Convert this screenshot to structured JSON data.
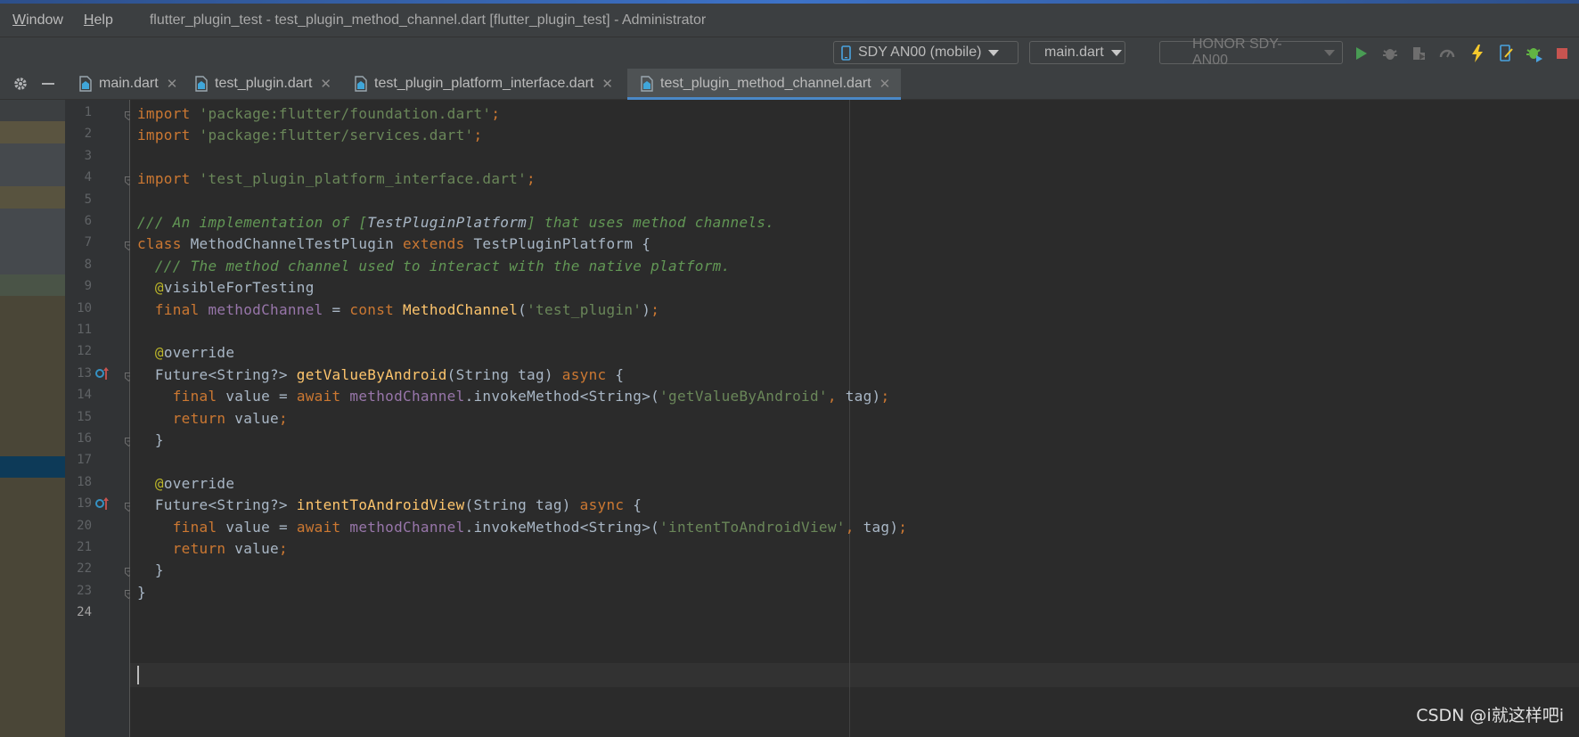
{
  "menubar": {
    "items": [
      {
        "label": "Window",
        "mnemonic": "W",
        "rest": "indow"
      },
      {
        "label": "Help",
        "mnemonic": "H",
        "rest": "elp"
      }
    ],
    "window_title": "flutter_plugin_test - test_plugin_method_channel.dart [flutter_plugin_test] - Administrator"
  },
  "toolbar": {
    "device_selector": "SDY AN00 (mobile)",
    "run_config": "main.dart",
    "device_list": "HONOR SDY-AN00",
    "icons": [
      "run-icon",
      "debug-icon",
      "coverage-icon",
      "profile-icon",
      "hot-reload-icon",
      "device-manager-icon",
      "attach-debugger-icon",
      "stop-icon"
    ],
    "colors": {
      "run": "#499c54",
      "reload": "#f4c82d",
      "stop": "#c75450"
    }
  },
  "tabs": [
    {
      "label": "main.dart"
    },
    {
      "label": "test_plugin.dart"
    },
    {
      "label": "test_plugin_platform_interface.dart"
    },
    {
      "label": "test_plugin_method_channel.dart",
      "active": true
    }
  ],
  "editor": {
    "current_line": 24,
    "lines": [
      [
        [
          "kw",
          "import "
        ],
        [
          "str",
          "'package:flutter/foundation.dart'"
        ],
        [
          "kw",
          ";"
        ]
      ],
      [
        [
          "kw",
          "import "
        ],
        [
          "str",
          "'package:flutter/services.dart'"
        ],
        [
          "kw",
          ";"
        ]
      ],
      [],
      [
        [
          "kw",
          "import "
        ],
        [
          "str",
          "'test_plugin_platform_interface.dart'"
        ],
        [
          "kw",
          ";"
        ]
      ],
      [],
      [
        [
          "doc",
          "/// An implementation of ["
        ],
        [
          "plaindoc",
          "TestPluginPlatform"
        ],
        [
          "doc",
          "] that uses method channels."
        ]
      ],
      [
        [
          "kw",
          "class "
        ],
        [
          "pl",
          "MethodChannelTestPlugin "
        ],
        [
          "kw",
          "extends "
        ],
        [
          "pl",
          "TestPluginPlatform {"
        ]
      ],
      [
        [
          "pl",
          "  "
        ],
        [
          "doc",
          "/// The method channel used to interact with the native platform."
        ]
      ],
      [
        [
          "pl",
          "  "
        ],
        [
          "ann",
          "@"
        ],
        [
          "pl",
          "visibleForTesting"
        ]
      ],
      [
        [
          "pl",
          "  "
        ],
        [
          "kw",
          "final "
        ],
        [
          "fld",
          "methodChannel "
        ],
        [
          "pl",
          "= "
        ],
        [
          "kw",
          "const "
        ],
        [
          "fn",
          "MethodChannel"
        ],
        [
          "pl",
          "("
        ],
        [
          "str",
          "'test_plugin'"
        ],
        [
          "pl",
          ")"
        ],
        [
          "kw",
          ";"
        ]
      ],
      [],
      [
        [
          "pl",
          "  "
        ],
        [
          "ann",
          "@"
        ],
        [
          "pl",
          "override"
        ]
      ],
      [
        [
          "pl",
          "  Future<String?> "
        ],
        [
          "fn",
          "getValueByAndroid"
        ],
        [
          "pl",
          "(String tag) "
        ],
        [
          "kw",
          "async "
        ],
        [
          "pl",
          "{"
        ]
      ],
      [
        [
          "pl",
          "    "
        ],
        [
          "kw",
          "final "
        ],
        [
          "pl",
          "value = "
        ],
        [
          "kw",
          "await "
        ],
        [
          "fld",
          "methodChannel"
        ],
        [
          "pl",
          ".invokeMethod<String>("
        ],
        [
          "str",
          "'getValueByAndroid'"
        ],
        [
          "kw",
          ", "
        ],
        [
          "pl",
          "tag)"
        ],
        [
          "kw",
          ";"
        ]
      ],
      [
        [
          "pl",
          "    "
        ],
        [
          "kw",
          "return "
        ],
        [
          "pl",
          "value"
        ],
        [
          "kw",
          ";"
        ]
      ],
      [
        [
          "pl",
          "  }"
        ]
      ],
      [],
      [
        [
          "pl",
          "  "
        ],
        [
          "ann",
          "@"
        ],
        [
          "pl",
          "override"
        ]
      ],
      [
        [
          "pl",
          "  Future<String?> "
        ],
        [
          "fn",
          "intentToAndroidView"
        ],
        [
          "pl",
          "(String tag) "
        ],
        [
          "kw",
          "async "
        ],
        [
          "pl",
          "{"
        ]
      ],
      [
        [
          "pl",
          "    "
        ],
        [
          "kw",
          "final "
        ],
        [
          "pl",
          "value = "
        ],
        [
          "kw",
          "await "
        ],
        [
          "fld",
          "methodChannel"
        ],
        [
          "pl",
          ".invokeMethod<String>("
        ],
        [
          "str",
          "'intentToAndroidView'"
        ],
        [
          "kw",
          ", "
        ],
        [
          "pl",
          "tag)"
        ],
        [
          "kw",
          ";"
        ]
      ],
      [
        [
          "pl",
          "    "
        ],
        [
          "kw",
          "return "
        ],
        [
          "pl",
          "value"
        ],
        [
          "kw",
          ";"
        ]
      ],
      [
        [
          "pl",
          "  }"
        ]
      ],
      [
        [
          "pl",
          "}"
        ]
      ],
      []
    ],
    "override_marker_lines": [
      13,
      19
    ],
    "fold_marker_lines": [
      1,
      4,
      7,
      13,
      16,
      19,
      22,
      23
    ],
    "colors": {
      "keyword": "#cc7832",
      "string": "#6a8759",
      "doc_comment": "#629755",
      "annotation": "#bbb529",
      "function": "#ffc66d",
      "field": "#9876aa",
      "plain": "#a9b7c6"
    }
  },
  "watermark": "CSDN @i就这样吧i"
}
